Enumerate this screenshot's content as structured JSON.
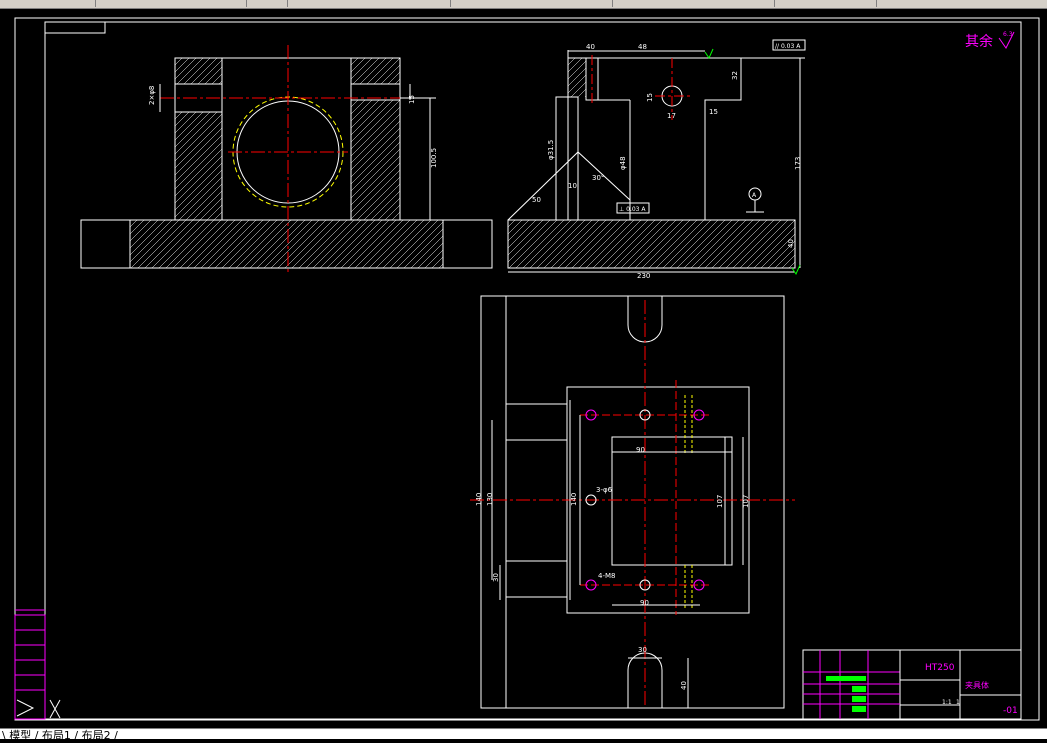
{
  "drawing": {
    "finish_note": "其余",
    "finish_symbol_value": "6.3",
    "material": "HT250",
    "part_name": "夹具体",
    "drawing_number": "-01",
    "scale_a": "1:1",
    "scale_b": "1"
  },
  "dims": {
    "top_w40": "40",
    "top_w48": "48",
    "flatness": "// 0.03 A",
    "d32": "32",
    "d15a": "15",
    "d17": "17",
    "d15b": "15",
    "d173": "173",
    "d40": "40",
    "d230": "230",
    "d50": "50",
    "d10": "10",
    "d30deg": "30°",
    "phi31": "φ31.5",
    "phi48": "φ48",
    "perp": "⊥ 0.03 A",
    "datum_a": "A",
    "front_100": "100.5",
    "front_15": "15",
    "front_left": "2×φ8",
    "plan_90_top": "90",
    "plan_90_bot": "90",
    "plan_107a": "107",
    "plan_107b": "107",
    "plan_140a": "140",
    "plan_140b": "140",
    "plan_130": "130",
    "plan_30": "30",
    "plan_holes_a": "3-φ6",
    "plan_holes_b": "4-M8",
    "slot_30": "30",
    "slot_40": "40"
  },
  "layout_tabs": "\\ 模型 / 布局1 / 布局2 /",
  "colors": {
    "bg": "#000000",
    "outline": "#ffffff",
    "center": "#ff0000",
    "hidden": "#ffff00",
    "title": "#ff00ff",
    "accent": "#00ff00"
  }
}
